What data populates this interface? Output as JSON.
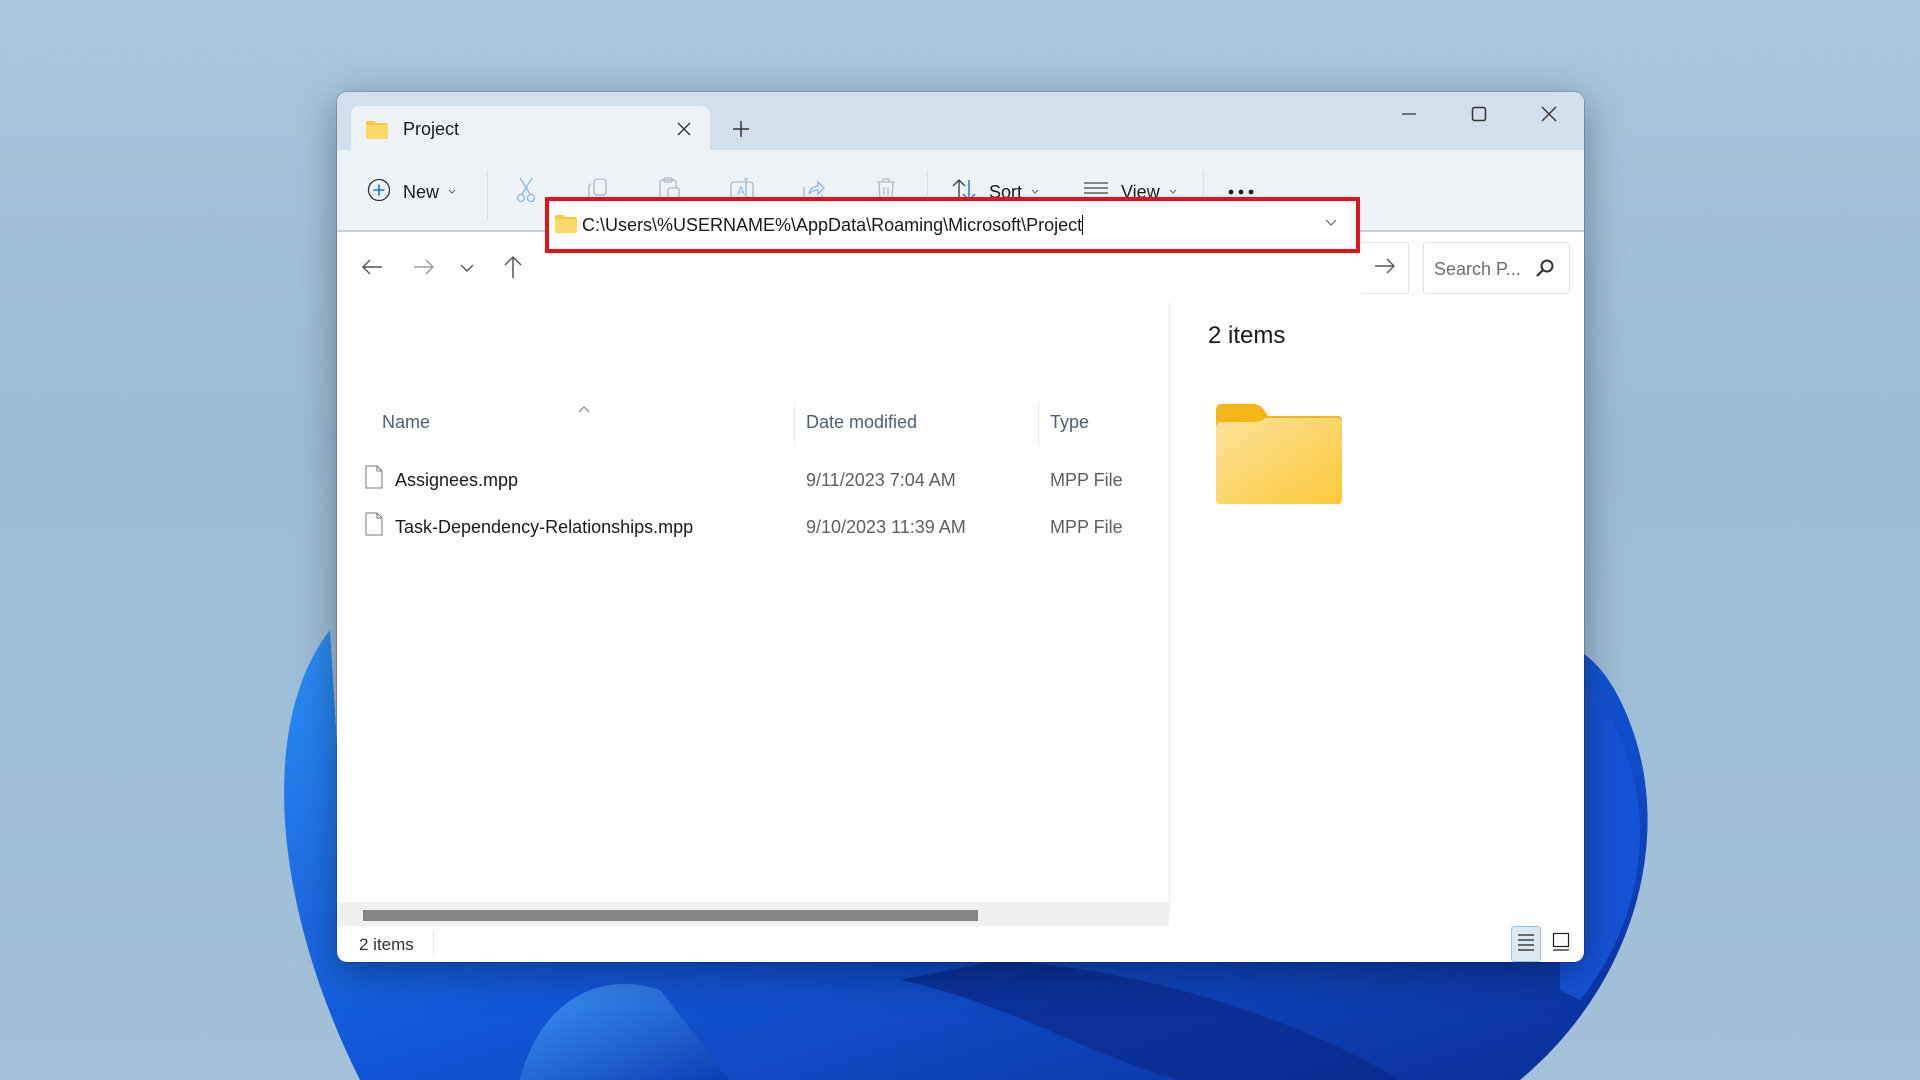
{
  "window": {
    "tab_title": "Project",
    "new_tab_label": "+"
  },
  "toolbar": {
    "new_label": "New",
    "sort_label": "Sort",
    "view_label": "View",
    "more_label": "•••",
    "icons": [
      "add-circle-icon",
      "cut-icon",
      "copy-icon",
      "paste-icon",
      "rename-icon",
      "share-icon",
      "delete-icon",
      "sort-icon",
      "view-icon",
      "more-icon"
    ]
  },
  "address": {
    "path": "C:\\Users\\%USERNAME%\\AppData\\Roaming\\Microsoft\\Project",
    "highlight_color": "#e3131b"
  },
  "search": {
    "placeholder": "Search P..."
  },
  "columns": {
    "name": "Name",
    "date": "Date modified",
    "type": "Type"
  },
  "files": [
    {
      "name": "Assignees.mpp",
      "date": "9/11/2023 7:04 AM",
      "type": "MPP File"
    },
    {
      "name": "Task-Dependency-Relationships.mpp",
      "date": "9/10/2023 11:39 AM",
      "type": "MPP File"
    }
  ],
  "preview": {
    "count_label": "2 items"
  },
  "status": {
    "count_label": "2 items"
  },
  "colors": {
    "folder": "#f8c93d",
    "accent": "#1a73c9",
    "tabbar": "#d1e0ec",
    "toolbar": "#eef3f8"
  }
}
